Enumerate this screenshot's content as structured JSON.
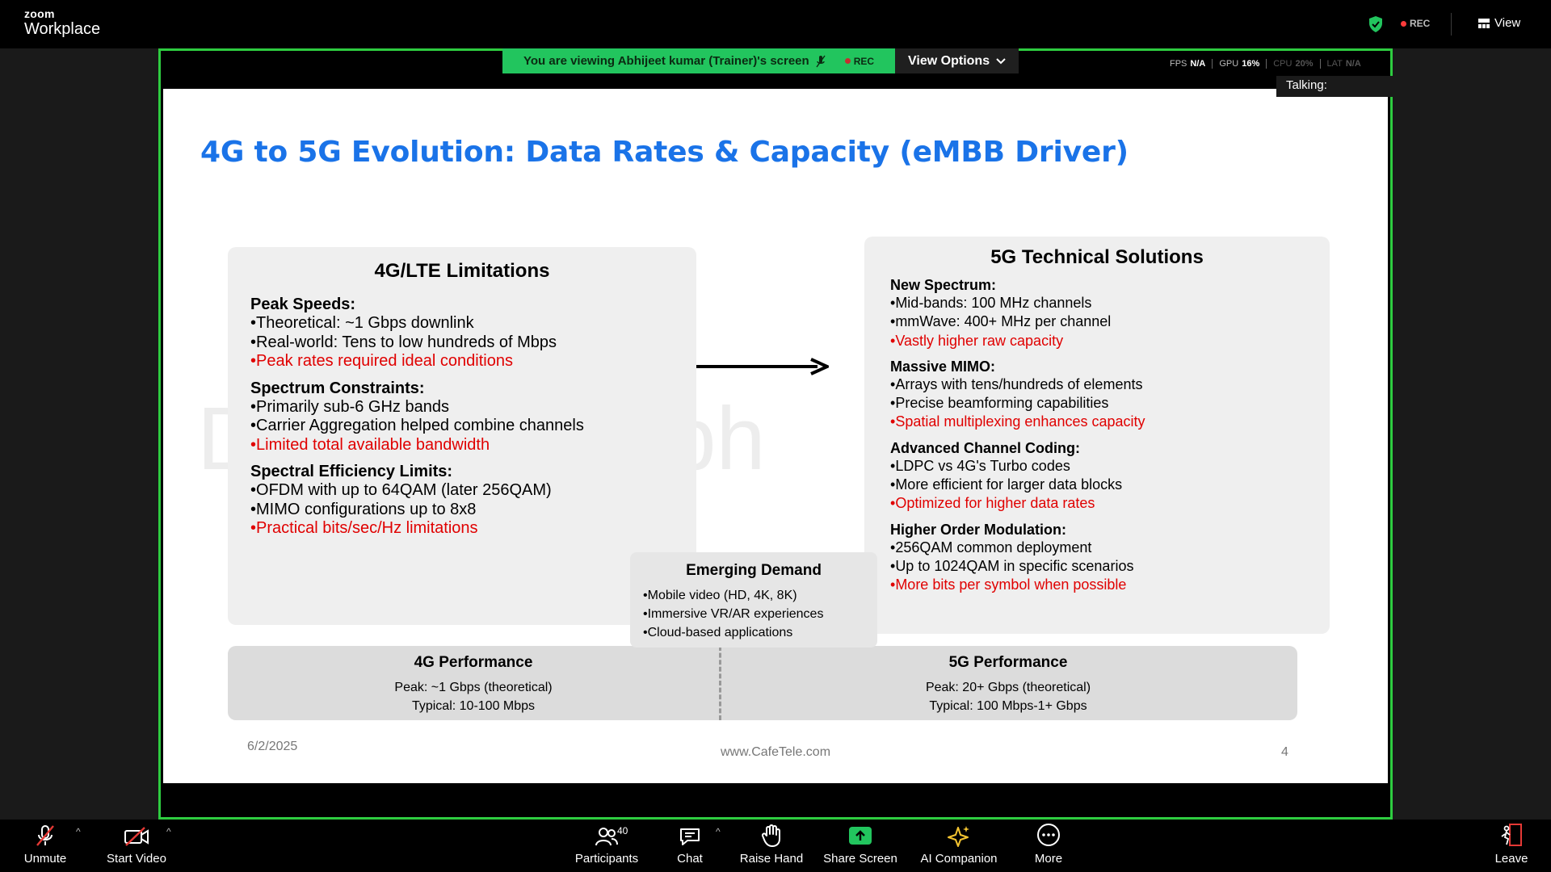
{
  "app": {
    "brand_top": "zoom",
    "brand_bottom": "Workplace"
  },
  "top": {
    "rec": "REC",
    "view_label": "View"
  },
  "share": {
    "viewing_text": "You are viewing  Abhijeet kumar (Trainer)'s screen",
    "rec": "REC",
    "view_options": "View Options",
    "talking": "Talking:",
    "stats": [
      {
        "label": "FPS",
        "value": "N/A"
      },
      {
        "label": "GPU",
        "value": "16%"
      },
      {
        "label": "CPU",
        "value": "20%"
      },
      {
        "label": "LAT",
        "value": "N/A"
      }
    ]
  },
  "slide": {
    "title": "4G to 5G Evolution: Data Rates & Capacity (eMBB Driver)",
    "left": {
      "title": "4G/LTE Limitations",
      "sections": [
        {
          "heading": "Peak Speeds:",
          "items": [
            "Theoretical: ~1 Gbps downlink",
            "Real-world: Tens to low hundreds of Mbps"
          ],
          "highlight": "Peak rates required ideal conditions"
        },
        {
          "heading": "Spectrum Constraints:",
          "items": [
            "Primarily sub-6 GHz bands",
            "Carrier Aggregation helped combine channels"
          ],
          "highlight": "Limited total available bandwidth"
        },
        {
          "heading": "Spectral Efficiency Limits:",
          "items": [
            "OFDM with up to 64QAM (later 256QAM)",
            "MIMO configurations up to 8x8"
          ],
          "highlight": "Practical bits/sec/Hz limitations"
        }
      ]
    },
    "right": {
      "title": "5G Technical Solutions",
      "sections": [
        {
          "heading": "New Spectrum:",
          "items": [
            "Mid-bands: 100 MHz channels",
            "mmWave: 400+ MHz per channel"
          ],
          "highlight": "Vastly higher raw capacity"
        },
        {
          "heading": "Massive MIMO:",
          "items": [
            "Arrays with tens/hundreds of elements",
            "Precise beamforming capabilities"
          ],
          "highlight": "Spatial multiplexing enhances capacity"
        },
        {
          "heading": "Advanced Channel Coding:",
          "items": [
            "LDPC vs 4G's Turbo codes",
            "More efficient for larger data blocks"
          ],
          "highlight": "Optimized for higher data rates"
        },
        {
          "heading": "Higher Order Modulation:",
          "items": [
            "256QAM common deployment",
            "Up to 1024QAM in specific scenarios"
          ],
          "highlight": "More bits per symbol when possible"
        }
      ]
    },
    "demand": {
      "title": "Emerging Demand",
      "items": [
        "Mobile video (HD, 4K, 8K)",
        "Immersive VR/AR experiences",
        "Cloud-based applications"
      ]
    },
    "perf": {
      "left": {
        "title": "4G Performance",
        "peak": "Peak: ~1 Gbps (theoretical)",
        "typical": "Typical: 10-100 Mbps"
      },
      "right": {
        "title": "5G Performance",
        "peak": "Peak: 20+ Gbps (theoretical)",
        "typical": "Typical: 100 Mbps-1+ Gbps"
      }
    },
    "footer": {
      "date": "6/2/2025",
      "site": "www.CafeTele.com",
      "page": "4"
    }
  },
  "toolbar": {
    "unmute": "Unmute",
    "start_video": "Start Video",
    "participants": "Participants",
    "participants_count": "40",
    "chat": "Chat",
    "raise_hand": "Raise Hand",
    "share_screen": "Share Screen",
    "ai_companion": "AI Companion",
    "more": "More",
    "leave": "Leave"
  },
  "colors": {
    "accent_green": "#2ecc40",
    "title_blue": "#1a73e8",
    "highlight_red": "#e00000",
    "rec_red": "#ff3b3b"
  }
}
